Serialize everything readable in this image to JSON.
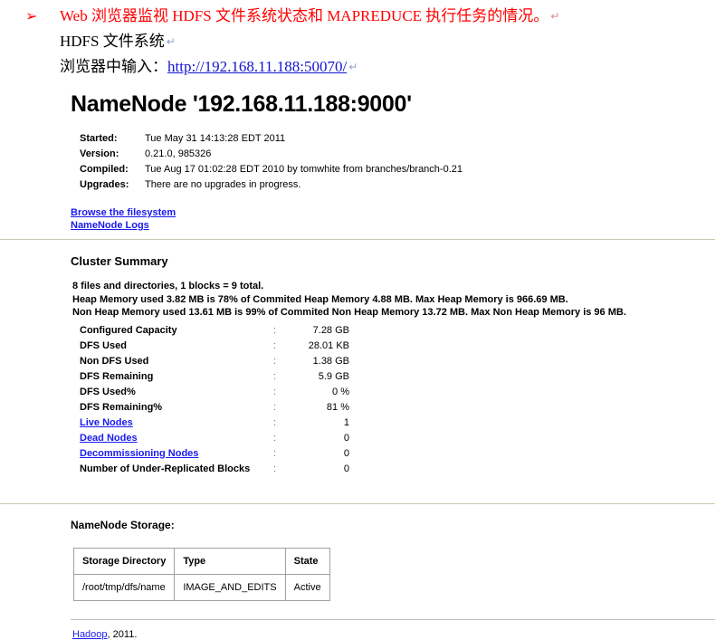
{
  "document": {
    "bullet_glyph": "➢",
    "line1_red": "Web 浏览器监视 HDFS 文件系统状态和 MAPREDUCE 执行任务的情况。",
    "line2": "HDFS 文件系统",
    "line3_prefix": "浏览器中输入：",
    "line3_url": "http://192.168.11.188:50070/",
    "return_mark": "↵"
  },
  "namenode": {
    "title": "NameNode '192.168.11.188:9000'",
    "info": [
      {
        "label": "Started:",
        "value": "Tue May 31 14:13:28 EDT 2011"
      },
      {
        "label": "Version:",
        "value": "0.21.0, 985326"
      },
      {
        "label": "Compiled:",
        "value": "Tue Aug 17 01:02:28 EDT 2010 by tomwhite from branches/branch-0.21"
      },
      {
        "label": "Upgrades:",
        "value": "There are no upgrades in progress."
      }
    ],
    "links": [
      {
        "label": "Browse the filesystem"
      },
      {
        "label": "NameNode Logs"
      }
    ],
    "cluster_summary": {
      "heading": "Cluster Summary",
      "lines": [
        "8 files and directories, 1 blocks = 9 total.",
        "Heap Memory used 3.82 MB is 78% of Commited Heap Memory 4.88 MB. Max Heap Memory is 966.69 MB.",
        "Non Heap Memory used 13.61 MB is 99% of Commited Non Heap Memory 13.72 MB. Max Non Heap Memory is 96 MB."
      ],
      "separator": ":",
      "rows": [
        {
          "key": "Configured Capacity",
          "value": "7.28 GB",
          "link": false
        },
        {
          "key": "DFS Used",
          "value": "28.01 KB",
          "link": false
        },
        {
          "key": "Non DFS Used",
          "value": "1.38 GB",
          "link": false
        },
        {
          "key": "DFS Remaining",
          "value": "5.9 GB",
          "link": false
        },
        {
          "key": "DFS Used%",
          "value": "0 %",
          "link": false
        },
        {
          "key": "DFS Remaining%",
          "value": "81 %",
          "link": false
        },
        {
          "key": "Live Nodes",
          "value": "1",
          "link": true
        },
        {
          "key": "Dead Nodes",
          "value": "0",
          "link": true
        },
        {
          "key": "Decommissioning Nodes",
          "value": "0",
          "link": true
        },
        {
          "key": "Number of Under-Replicated Blocks",
          "value": "0",
          "link": false
        }
      ]
    },
    "storage": {
      "heading": "NameNode Storage:",
      "columns": [
        "Storage Directory",
        "Type",
        "State"
      ],
      "rows": [
        [
          "/root/tmp/dfs/name",
          "IMAGE_AND_EDITS",
          "Active"
        ]
      ]
    },
    "footer": {
      "link": "Hadoop",
      "rest": ", 2011."
    }
  },
  "colors": {
    "doc_red": "#ff0000",
    "link_blue": "#1a1aee",
    "rule": "#c9c7ad"
  }
}
